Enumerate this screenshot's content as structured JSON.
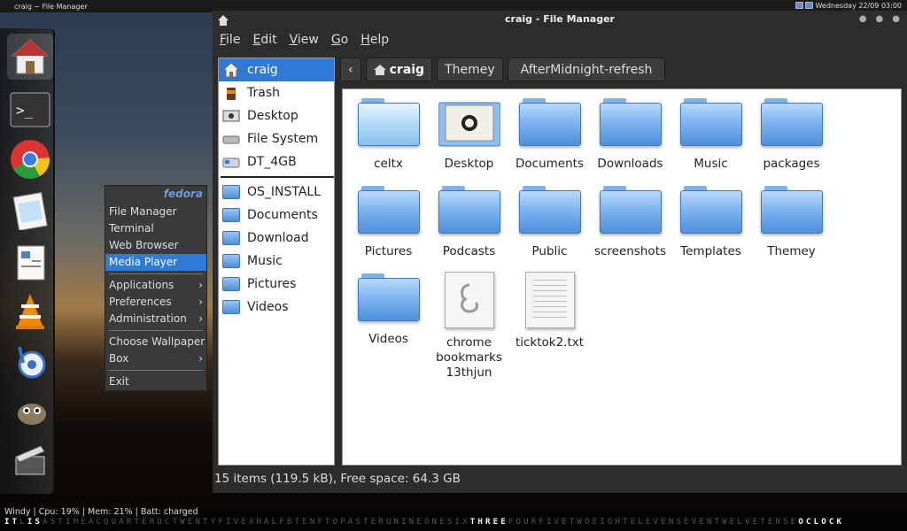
{
  "top_panel": {
    "title": "craig ~ File Manager",
    "clock": "Wednesday 22/09 03:00"
  },
  "dock": {
    "items": [
      "home-icon",
      "terminal-icon",
      "chrome-icon",
      "text-editor-icon",
      "office-icon",
      "vlc-icon",
      "blender-icon",
      "gimp-icon",
      "video-editor-icon"
    ]
  },
  "context_menu": {
    "brand": "fedora",
    "items": [
      {
        "label": "File Manager"
      },
      {
        "label": "Terminal"
      },
      {
        "label": "Web Browser"
      },
      {
        "label": "Media Player",
        "selected": true
      }
    ],
    "submenus": [
      {
        "label": "Applications",
        "arrow": "›"
      },
      {
        "label": "Preferences",
        "arrow": "›"
      },
      {
        "label": "Administration",
        "arrow": "›"
      }
    ],
    "extras": [
      {
        "label": "Choose Wallpaper"
      },
      {
        "label": "Box",
        "arrow": "›"
      }
    ],
    "exit": "Exit"
  },
  "window": {
    "title": "craig - File Manager",
    "menu": [
      "File",
      "Edit",
      "View",
      "Go",
      "Help"
    ],
    "sidebar": {
      "places": [
        {
          "label": "craig",
          "icon": "home-icon",
          "selected": true
        },
        {
          "label": "Trash",
          "icon": "trash-icon"
        },
        {
          "label": "Desktop",
          "icon": "desktop-icon"
        },
        {
          "label": "File System",
          "icon": "drive-icon"
        },
        {
          "label": "DT_4GB",
          "icon": "usb-drive-icon"
        }
      ],
      "bookmarks": [
        {
          "label": "OS_INSTALL"
        },
        {
          "label": "Documents"
        },
        {
          "label": "Download"
        },
        {
          "label": "Music"
        },
        {
          "label": "Pictures"
        },
        {
          "label": "Videos"
        }
      ]
    },
    "pathbar": {
      "back": "‹",
      "items": [
        "craig",
        "Themey",
        "AfterMidnight-refresh"
      ]
    },
    "files": [
      {
        "name": "celtx",
        "type": "folder-light"
      },
      {
        "name": "Desktop",
        "type": "desktop"
      },
      {
        "name": "Documents",
        "type": "folder"
      },
      {
        "name": "Downloads",
        "type": "folder"
      },
      {
        "name": "Music",
        "type": "folder"
      },
      {
        "name": "packages",
        "type": "folder"
      },
      {
        "name": "Pictures",
        "type": "folder"
      },
      {
        "name": "Podcasts",
        "type": "folder"
      },
      {
        "name": "Public",
        "type": "folder"
      },
      {
        "name": "screenshots",
        "type": "folder"
      },
      {
        "name": "Templates",
        "type": "folder"
      },
      {
        "name": "Themey",
        "type": "folder"
      },
      {
        "name": "Videos",
        "type": "folder"
      },
      {
        "name": "chrome bookmarks 13thjun",
        "type": "gnome-doc"
      },
      {
        "name": "ticktok2.txt",
        "type": "text"
      }
    ],
    "status": "15 items (119.5 kB), Free space: 64.3 GB"
  },
  "bottom_status": "Windy |  Cpu: 19%  | Mem: 21%  | Batt: charged",
  "word_clock": {
    "segments": [
      {
        "text": "IT",
        "on": true
      },
      {
        "text": "L",
        "on": false
      },
      {
        "text": "IS",
        "on": true
      },
      {
        "text": "ASTIMEACQUARTERDCTWENTYFIVEXHALFBTENFTOPASTERUNINEONESIX",
        "on": false
      },
      {
        "text": "THREE",
        "on": true
      },
      {
        "text": "FOURFIVETWOEIGHTELEVENSEVENTWELVETENSE",
        "on": false
      },
      {
        "text": "OCLOCK",
        "on": true
      }
    ]
  }
}
